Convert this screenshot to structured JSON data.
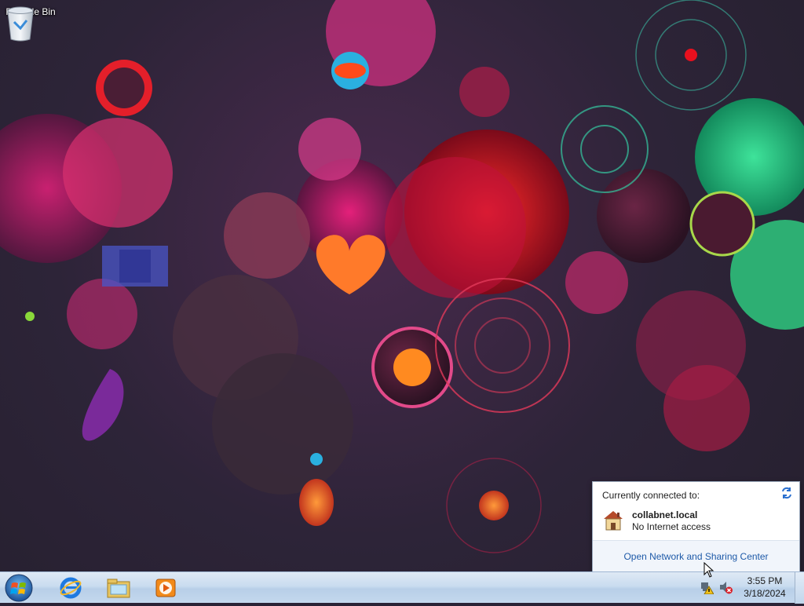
{
  "desktop": {
    "icons": [
      {
        "label": "Recycle Bin",
        "icon": "recycle-bin-icon"
      }
    ]
  },
  "taskbar": {
    "start": {
      "icon": "windows-start-orb-icon"
    },
    "pinned": [
      {
        "name": "Internet Explorer",
        "icon": "internet-explorer-icon"
      },
      {
        "name": "Windows Explorer",
        "icon": "windows-explorer-icon"
      },
      {
        "name": "Windows Media Player",
        "icon": "media-player-icon"
      }
    ],
    "tray": {
      "network_icon": "network-warning-icon",
      "volume_icon": "volume-muted-icon",
      "time": "3:55 PM",
      "date": "3/18/2024"
    }
  },
  "network_popup": {
    "title": "Currently connected to:",
    "network_name": "collabnet.local",
    "network_status": "No Internet access",
    "link": "Open Network and Sharing Center",
    "accent": "#1e5aa8"
  }
}
